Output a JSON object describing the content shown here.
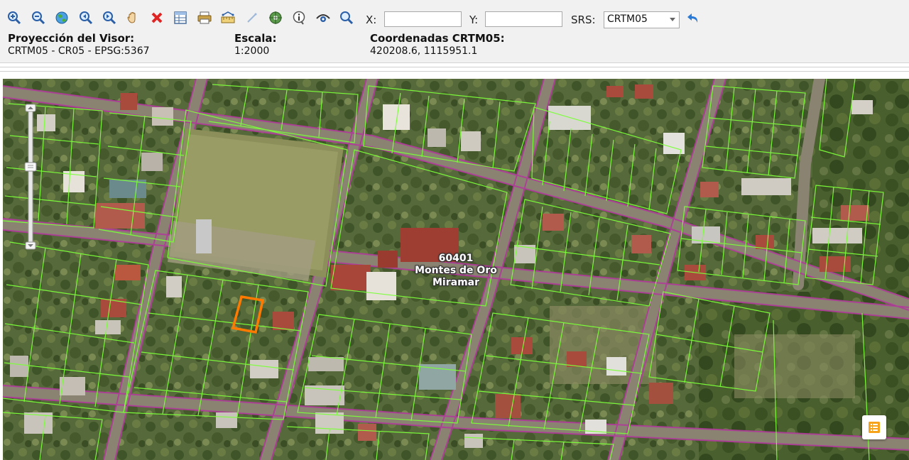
{
  "toolbar": {
    "tools": [
      {
        "name": "zoom-in-icon"
      },
      {
        "name": "zoom-out-icon"
      },
      {
        "name": "globe-icon"
      },
      {
        "name": "zoom-previous-icon"
      },
      {
        "name": "zoom-next-icon"
      },
      {
        "name": "pan-hand-icon"
      },
      {
        "name": "clear-icon"
      },
      {
        "name": "table-icon"
      },
      {
        "name": "print-icon"
      },
      {
        "name": "measure-icon"
      },
      {
        "name": "draw-line-icon"
      },
      {
        "name": "locate-icon"
      },
      {
        "name": "info-icon"
      },
      {
        "name": "view-icon"
      },
      {
        "name": "search-icon"
      }
    ]
  },
  "coords": {
    "x_label": "X:",
    "x_value": "",
    "y_label": "Y:",
    "y_value": "",
    "srs_label": "SRS:",
    "srs_value": "CRTM05"
  },
  "info": {
    "projection_heading": "Proyección del Visor:",
    "projection_value": "CRTM05 - CR05 - EPSG:5367",
    "scale_heading": "Escala:",
    "scale_value": "1:2000",
    "coords_heading": "Coordenadas CRTM05:",
    "coords_value": "420208.6, 1115951.1"
  },
  "map": {
    "label_code": "60401",
    "label_canton": "Montes de Oro",
    "label_district": "Miramar",
    "parcel_line_color": "#7cff3a",
    "road_color": "#b03a9a",
    "selected_parcel_color": "#ff7a00"
  }
}
